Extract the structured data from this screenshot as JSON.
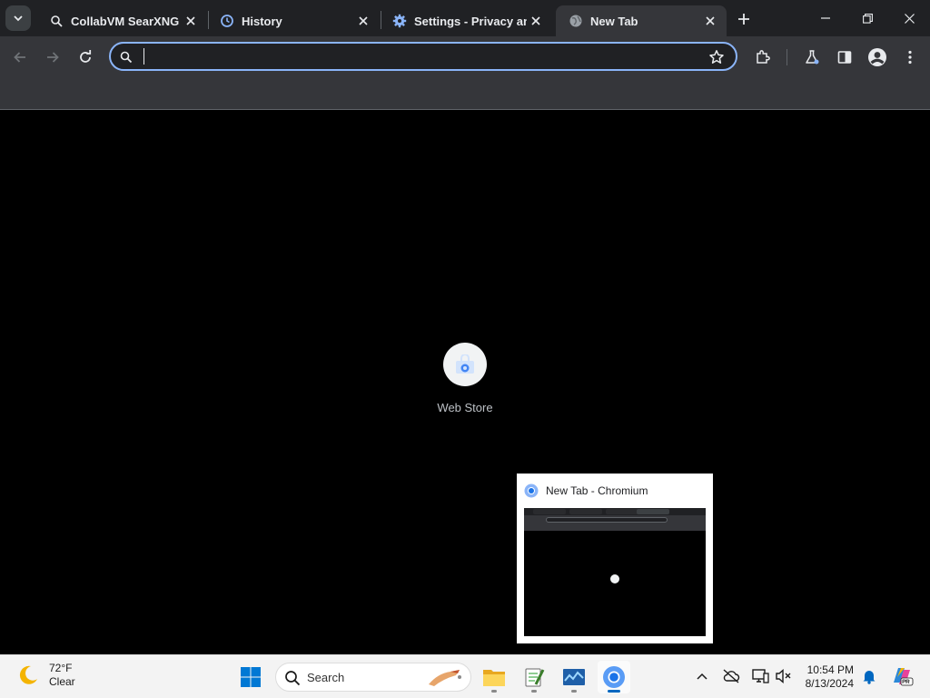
{
  "browser": {
    "tabs": [
      {
        "title": "CollabVM SearXNG",
        "active": false
      },
      {
        "title": "History",
        "active": false
      },
      {
        "title": "Settings - Privacy and",
        "active": false
      },
      {
        "title": "New Tab",
        "active": true
      }
    ],
    "omnibox": {
      "value": "",
      "placeholder": ""
    },
    "shortcut": {
      "label": "Web Store"
    }
  },
  "taskbar": {
    "weather": {
      "temp": "72°F",
      "condition": "Clear"
    },
    "search_label": "Search",
    "preview_title": "New Tab - Chromium",
    "clock": {
      "time": "10:54 PM",
      "date": "8/13/2024"
    }
  },
  "colors": {
    "accent": "#8ab4f8",
    "tab_bg": "#202124",
    "toolbar_bg": "#35363a",
    "taskbar_accent": "#0067c0"
  }
}
